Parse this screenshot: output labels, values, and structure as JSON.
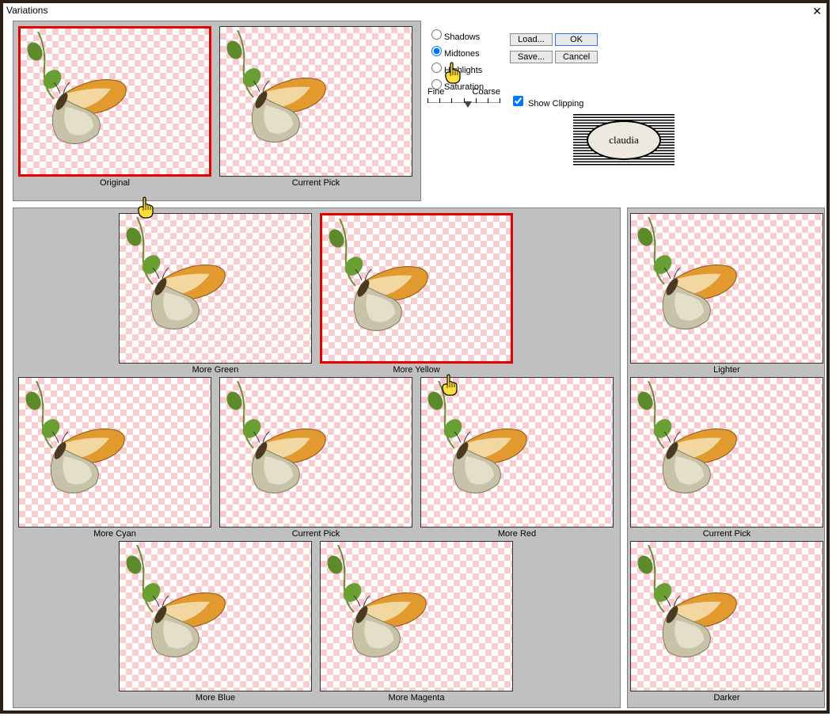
{
  "window": {
    "title": "Variations"
  },
  "top": {
    "left": {
      "label": "Original"
    },
    "right": {
      "label": "Current Pick"
    }
  },
  "main": {
    "r1c2": {
      "label": "More Green"
    },
    "r1c3": {
      "label": "More Yellow"
    },
    "r2c1": {
      "label": "More Cyan"
    },
    "r2c2": {
      "label": "Current Pick"
    },
    "r2c3": {
      "label": "More Red"
    },
    "r3c2": {
      "label": "More Blue"
    },
    "r3c3": {
      "label": "More Magenta"
    }
  },
  "right": {
    "r1": {
      "label": "Lighter"
    },
    "r2": {
      "label": "Current Pick"
    },
    "r3": {
      "label": "Darker"
    }
  },
  "radio": {
    "shadows": "Shadows",
    "midtones": "Midtones",
    "highlights": "Highlights",
    "saturation": "Saturation",
    "selected": "midtones"
  },
  "slider": {
    "left": "Fine",
    "right": "Coarse"
  },
  "showClipping": {
    "label": "Show Clipping",
    "checked": true
  },
  "buttons": {
    "load": "Load...",
    "ok": "OK",
    "save": "Save...",
    "cancel": "Cancel"
  },
  "logo": {
    "text": "claudia"
  }
}
